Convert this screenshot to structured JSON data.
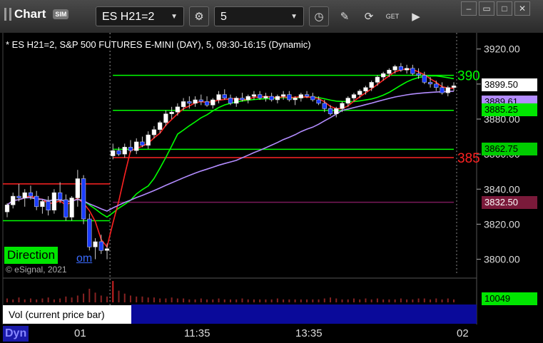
{
  "toolbar": {
    "title": "Chart",
    "sim_badge": "SIM",
    "symbol": "ES H21=2",
    "interval": "5",
    "get_badge": "GET"
  },
  "chart": {
    "header": "* ES H21=2, S&P 500 FUTURES E-MINI (DAY), 5, 09:30-16:15 (Dynamic)",
    "direction_label": "Direction",
    "link_fragment": "om",
    "copyright": "© eSignal, 2021",
    "volume_label": "Vol (current price bar)",
    "volume_value": "10049",
    "dyn_label": "Dyn",
    "level_green_label": "390",
    "level_red_label": "385"
  },
  "chart_data": {
    "type": "candlestick",
    "y_ticks": [
      "3920.00",
      "3900.00",
      "3880.00",
      "3860.00",
      "3840.00",
      "3820.00",
      "3800.00"
    ],
    "ylim": [
      3788,
      3926
    ],
    "x_ticks": [
      "01",
      "11:35",
      "13:35",
      "02"
    ],
    "price_tags": [
      {
        "value": "3899.50",
        "bg": "#ffffff",
        "fg": "#000000"
      },
      {
        "value": "3889.61",
        "bg": "#b38cff",
        "fg": "#000000"
      },
      {
        "value": "3885.25",
        "bg": "#00e600",
        "fg": "#000000"
      },
      {
        "value": "3862.75",
        "bg": "#00cc00",
        "fg": "#000000"
      },
      {
        "value": "3832.50",
        "bg": "#7a1a3a",
        "fg": "#ffffff"
      }
    ],
    "levels": [
      {
        "price": 3905,
        "color": "#00ff00"
      },
      {
        "price": 3885,
        "color": "#00ff00"
      },
      {
        "price": 3862.75,
        "color": "#00ff00"
      },
      {
        "price": 3858,
        "color": "#ff2222"
      },
      {
        "price": 3832.5,
        "color": "#7a1a5a"
      }
    ],
    "prev_day_levels": [
      {
        "price": 3843,
        "color": "#ff2222"
      },
      {
        "price": 3822,
        "color": "#00ff00"
      }
    ],
    "candles": [
      [
        3827,
        3832,
        3824,
        3831
      ],
      [
        3831,
        3838,
        3829,
        3836
      ],
      [
        3836,
        3843,
        3833,
        3835
      ],
      [
        3835,
        3840,
        3830,
        3838
      ],
      [
        3838,
        3842,
        3834,
        3836
      ],
      [
        3836,
        3839,
        3828,
        3830
      ],
      [
        3830,
        3834,
        3826,
        3833
      ],
      [
        3833,
        3836,
        3825,
        3828
      ],
      [
        3828,
        3840,
        3826,
        3838
      ],
      [
        3838,
        3844,
        3832,
        3834
      ],
      [
        3834,
        3837,
        3822,
        3824
      ],
      [
        3824,
        3836,
        3822,
        3835
      ],
      [
        3835,
        3851,
        3830,
        3846
      ],
      [
        3846,
        3848,
        3820,
        3823
      ],
      [
        3823,
        3826,
        3805,
        3807
      ],
      [
        3807,
        3812,
        3800,
        3810
      ],
      [
        3810,
        3814,
        3803,
        3805
      ],
      [
        3805,
        3809,
        3800,
        3806
      ],
      [
        3859,
        3866,
        3857,
        3862
      ],
      [
        3862,
        3864,
        3859,
        3860
      ],
      [
        3860,
        3866,
        3858,
        3864
      ],
      [
        3864,
        3868,
        3861,
        3862
      ],
      [
        3862,
        3869,
        3860,
        3867
      ],
      [
        3867,
        3870,
        3864,
        3865
      ],
      [
        3865,
        3873,
        3863,
        3871
      ],
      [
        3871,
        3876,
        3869,
        3874
      ],
      [
        3874,
        3879,
        3872,
        3878
      ],
      [
        3878,
        3885,
        3876,
        3883
      ],
      [
        3883,
        3887,
        3880,
        3884
      ],
      [
        3884,
        3889,
        3882,
        3887
      ],
      [
        3887,
        3892,
        3885,
        3890
      ],
      [
        3890,
        3893,
        3886,
        3889
      ],
      [
        3889,
        3893,
        3887,
        3891
      ],
      [
        3891,
        3894,
        3888,
        3890
      ],
      [
        3890,
        3893,
        3887,
        3888
      ],
      [
        3888,
        3892,
        3886,
        3891
      ],
      [
        3891,
        3896,
        3889,
        3894
      ],
      [
        3894,
        3897,
        3891,
        3892
      ],
      [
        3892,
        3894,
        3888,
        3889
      ],
      [
        3889,
        3893,
        3887,
        3892
      ],
      [
        3892,
        3895,
        3890,
        3891
      ],
      [
        3891,
        3894,
        3889,
        3893
      ],
      [
        3893,
        3896,
        3891,
        3894
      ],
      [
        3894,
        3896,
        3891,
        3892
      ],
      [
        3892,
        3895,
        3890,
        3893
      ],
      [
        3893,
        3895,
        3890,
        3891
      ],
      [
        3891,
        3894,
        3889,
        3893
      ],
      [
        3893,
        3896,
        3891,
        3894
      ],
      [
        3894,
        3896,
        3890,
        3891
      ],
      [
        3891,
        3893,
        3888,
        3892
      ],
      [
        3892,
        3895,
        3890,
        3894
      ],
      [
        3894,
        3896,
        3892,
        3893
      ],
      [
        3893,
        3895,
        3890,
        3891
      ],
      [
        3891,
        3893,
        3888,
        3889
      ],
      [
        3889,
        3891,
        3884,
        3886
      ],
      [
        3886,
        3888,
        3882,
        3883
      ],
      [
        3883,
        3887,
        3881,
        3886
      ],
      [
        3886,
        3890,
        3884,
        3889
      ],
      [
        3889,
        3893,
        3887,
        3892
      ],
      [
        3892,
        3895,
        3890,
        3894
      ],
      [
        3894,
        3897,
        3892,
        3896
      ],
      [
        3896,
        3899,
        3894,
        3898
      ],
      [
        3898,
        3902,
        3896,
        3901
      ],
      [
        3901,
        3905,
        3899,
        3904
      ],
      [
        3904,
        3907,
        3902,
        3906
      ],
      [
        3906,
        3909,
        3904,
        3908
      ],
      [
        3908,
        3911,
        3906,
        3910
      ],
      [
        3910,
        3912,
        3907,
        3908
      ],
      [
        3908,
        3911,
        3906,
        3909
      ],
      [
        3909,
        3911,
        3905,
        3906
      ],
      [
        3906,
        3909,
        3903,
        3905
      ],
      [
        3905,
        3907,
        3900,
        3901
      ],
      [
        3901,
        3904,
        3898,
        3900
      ],
      [
        3900,
        3902,
        3896,
        3898
      ],
      [
        3898,
        3901,
        3894,
        3895
      ],
      [
        3895,
        3899,
        3893,
        3898
      ],
      [
        3898,
        3901,
        3896,
        3899
      ]
    ],
    "volume": [
      4,
      3,
      5,
      3,
      4,
      3,
      4,
      5,
      3,
      4,
      6,
      5,
      7,
      9,
      14,
      10,
      7,
      6,
      22,
      12,
      9,
      7,
      6,
      6,
      5,
      5,
      4,
      4,
      5,
      4,
      4,
      3,
      3,
      4,
      3,
      3,
      4,
      3,
      3,
      3,
      4,
      3,
      3,
      3,
      3,
      3,
      4,
      3,
      3,
      3,
      3,
      3,
      3,
      3,
      4,
      5,
      4,
      3,
      3,
      4,
      3,
      4,
      3,
      4,
      3,
      3,
      3,
      4,
      3,
      3,
      4,
      4,
      3,
      4,
      3,
      4,
      3
    ],
    "session_break_index": 18
  }
}
